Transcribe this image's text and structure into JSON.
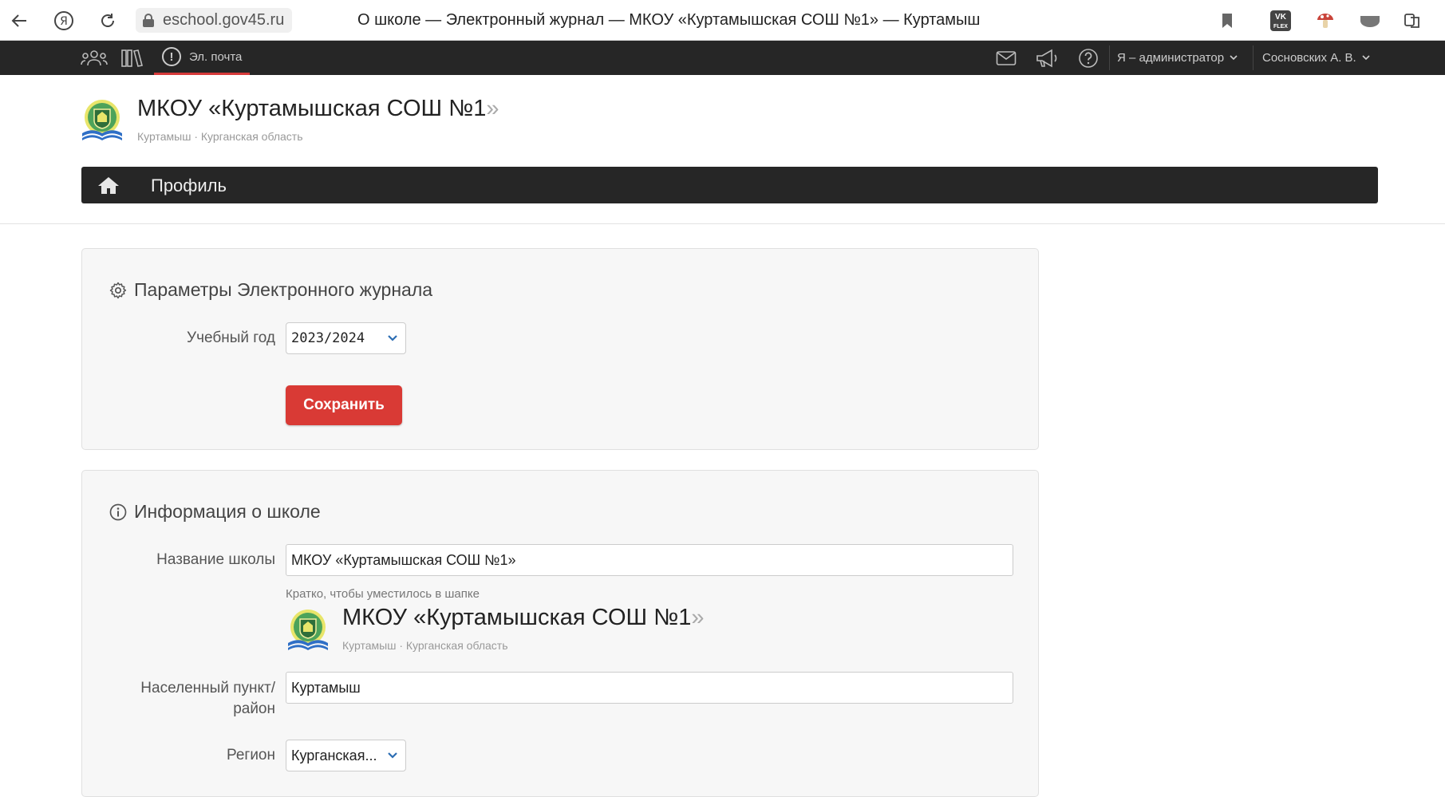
{
  "browser": {
    "url": "eschool.gov45.ru",
    "title": "О школе — Электронный журнал — МКОУ «Куртамышская СОШ №1» — Куртамыш",
    "vk_label_top": "VK",
    "vk_label_bottom": "FLEX"
  },
  "topbar": {
    "mail_label": "Эл. почта",
    "role_label": "Я – администратор",
    "user_label": "Сосновских А. В."
  },
  "school": {
    "name_main": "МКОУ «Куртамышская СОШ №1",
    "name_close": "»",
    "subtitle": "Куртамыш · Курганская область"
  },
  "nav": {
    "profile_label": "Профиль"
  },
  "params_panel": {
    "title": "Параметры Электронного журнала",
    "year_label": "Учебный год",
    "year_value": "2023/2024",
    "save_label": "Сохранить"
  },
  "info_panel": {
    "title": "Информация о школе",
    "name_label": "Название школы",
    "name_value": "МКОУ «Куртамышская СОШ №1»",
    "name_hint": "Кратко, чтобы уместилось в шапке",
    "preview_name_main": "МКОУ «Куртамышская СОШ №1",
    "preview_name_close": "»",
    "preview_subtitle": "Куртамыш · Курганская область",
    "town_label_line1": "Населенный пункт/",
    "town_label_line2": "район",
    "town_value": "Куртамыш",
    "region_label": "Регион",
    "region_value": "Курганская..."
  }
}
